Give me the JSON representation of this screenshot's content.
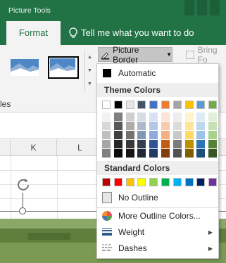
{
  "ribbon": {
    "context_tab_label": "Picture Tools",
    "active_tab": "Format",
    "tell_me": "Tell me what you want to do",
    "picture_border_label": "Picture Border",
    "bring_forward_label": "Bring Fo",
    "styles_group_label": "les"
  },
  "grid": {
    "columns": [
      "K",
      "L"
    ]
  },
  "menu": {
    "automatic": "Automatic",
    "theme_header": "Theme Colors",
    "standard_header": "Standard Colors",
    "no_outline": "No Outline",
    "more_colors": "More Outline Colors...",
    "weight": "Weight",
    "dashes": "Dashes",
    "theme_top": [
      "#ffffff",
      "#000000",
      "#e7e6e6",
      "#44546a",
      "#4472c4",
      "#ed7d31",
      "#a5a5a5",
      "#ffc000",
      "#5b9bd5",
      "#70ad47"
    ],
    "theme_tints": [
      [
        "#f2f2f2",
        "#d9d9d9",
        "#bfbfbf",
        "#a6a6a6",
        "#808080"
      ],
      [
        "#7f7f7f",
        "#595959",
        "#404040",
        "#262626",
        "#0d0d0d"
      ],
      [
        "#d0cece",
        "#aeaaaa",
        "#757171",
        "#3a3838",
        "#161616"
      ],
      [
        "#d6dce4",
        "#adb9ca",
        "#8497b0",
        "#333f4f",
        "#222a35"
      ],
      [
        "#d9e2f3",
        "#b4c6e7",
        "#8eaadb",
        "#2f5496",
        "#1f3864"
      ],
      [
        "#fbe4d5",
        "#f7caac",
        "#f4b083",
        "#c55a11",
        "#833c0b"
      ],
      [
        "#ededed",
        "#dbdbdb",
        "#c9c9c9",
        "#7b7b7b",
        "#525252"
      ],
      [
        "#fff2cc",
        "#fee599",
        "#ffd965",
        "#bf8f00",
        "#7f5f00"
      ],
      [
        "#deebf6",
        "#bdd7ee",
        "#9cc3e5",
        "#2e75b5",
        "#1e4e79"
      ],
      [
        "#e2efd9",
        "#c5e0b3",
        "#a8d08d",
        "#538135",
        "#375623"
      ]
    ],
    "standard": [
      "#c00000",
      "#ff0000",
      "#ffc000",
      "#ffff00",
      "#92d050",
      "#00b050",
      "#00b0f0",
      "#0070c0",
      "#002060",
      "#7030a0"
    ]
  }
}
